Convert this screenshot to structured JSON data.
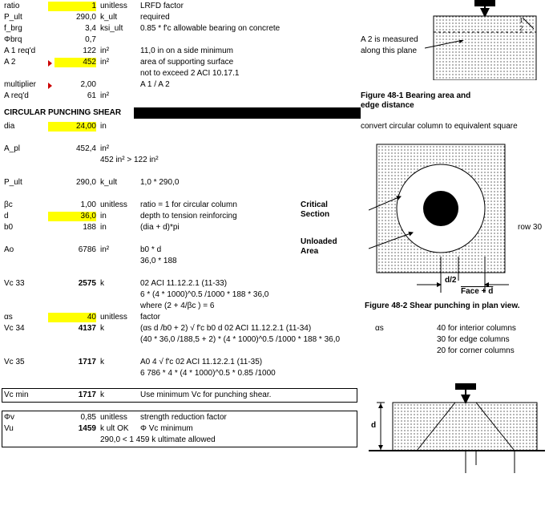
{
  "top": {
    "ratio": {
      "label": "ratio",
      "value": "1",
      "unit": "unitless",
      "note": "LRFD factor"
    },
    "P_ult": {
      "label": "P_ult",
      "value": "290,0",
      "unit": "k_ult",
      "note": "required"
    },
    "f_brg": {
      "label": "f_brg",
      "value": "3,4",
      "unit": "ksi_ult",
      "note": "0.85 * f'c   allowable bearing on concrete"
    },
    "phi_brg": {
      "label": "Φbrq",
      "value": "0,7",
      "unit": "",
      "note": ""
    },
    "A1_reqd": {
      "label": "A 1 req'd",
      "value": "122",
      "unit": "in²",
      "note": "11,0 in on a side minimum"
    },
    "A2": {
      "label": "A 2",
      "value": "452",
      "unit": "in²",
      "note": "area of supporting surface",
      "note2": "not to exceed 2  ACI 10.17.1"
    },
    "multiplier": {
      "label": "multiplier",
      "value": "2,00",
      "unit": "",
      "note": "A 1 / A 2"
    },
    "A_reqd": {
      "label": "A req'd",
      "value": "61",
      "unit": "in²",
      "note": ""
    },
    "A2_side": {
      "line1": "A 2 is measured",
      "line2": "along this plane"
    }
  },
  "section": {
    "title": "CIRCULAR PUNCHING SHEAR"
  },
  "punch": {
    "dia": {
      "label": "dia",
      "value": "24,00",
      "unit": "in",
      "note": ""
    },
    "dia_note": "convert circular column to equivalent square",
    "A_pl": {
      "label": "A_pl",
      "value": "452,4",
      "unit": "in²",
      "note": "",
      "check": "452 in² > 122 in²"
    },
    "P_ult": {
      "label": "P_ult",
      "value": "290,0",
      "unit": "k_ult",
      "note": "1,0 * 290,0"
    },
    "beta_c": {
      "label": "βc",
      "value": "1,00",
      "unit": "unitless",
      "note": "ratio = 1 for circular column"
    },
    "d": {
      "label": "d",
      "value": "36,0",
      "unit": "in",
      "note": "depth to tension reinforcing"
    },
    "b0": {
      "label": "b0",
      "value": "188",
      "unit": "in",
      "note": "(dia + d)*pi"
    },
    "Ao": {
      "label": "Ao",
      "value": "6786",
      "unit": "in²",
      "note": "b0 * d",
      "note2": "36,0 * 188"
    },
    "Vc33": {
      "label": "Vc 33",
      "value": "2575",
      "unit": "k",
      "note": "02 ACI 11.12.2.1  (11-33)",
      "note2": "6 * (4 * 1000)^0.5 /1000 * 188 * 36,0",
      "note3": "where (2 + 4/βc ) = 6"
    },
    "alpha_s": {
      "label": "αs",
      "value": "40",
      "unit": "unitless",
      "note": "factor"
    },
    "Vc34": {
      "label": "Vc 34",
      "value": "4137",
      "unit": "k",
      "note": "(αs d /b0 + 2)  √ f'c   b0  d   02 ACI 11.12.2.1  (11-34)",
      "note2": "(40 * 36,0 /188,5 + 2) * (4 * 1000)^0.5 /1000 * 188 * 36,0"
    },
    "alpha_side": {
      "label": "αs",
      "l1": "40 for interior columns",
      "l2": "30 for edge columns",
      "l3": "20 for corner columns"
    },
    "Vc35": {
      "label": "Vc 35",
      "value": "1717",
      "unit": "k",
      "note": "A0 4  √ f'c      02 ACI 11.12.2.1  (11-35)",
      "note2": "6 786 * 4 * (4 * 1000)^0.5 * 0.85 /1000"
    },
    "Vc_min": {
      "label": "Vc min",
      "value": "1717",
      "unit": "k",
      "note": "Use minimum Vc for punching shear."
    },
    "phi_v": {
      "label": "Φv",
      "value": "0,85",
      "unit": "unitless",
      "note": "strength reduction factor"
    },
    "Vu": {
      "label": "Vu",
      "value": "1459",
      "unit": "k ult OK",
      "note": "Φ Vc minimum",
      "note2": "290,0 < 1 459 k ultimate allowed"
    }
  },
  "fig1": {
    "caption1": "Figure 48-1 Bearing area and",
    "caption2": "edge distance"
  },
  "fig2": {
    "critical": "Critical",
    "section": "Section",
    "unloaded": "Unloaded",
    "area": "Area",
    "d2": "d/2",
    "face_d": "Face + d",
    "caption": "Figure 48-2 Shear punching in plan view."
  },
  "fig3": {
    "d": "d"
  },
  "row30": "row 30"
}
